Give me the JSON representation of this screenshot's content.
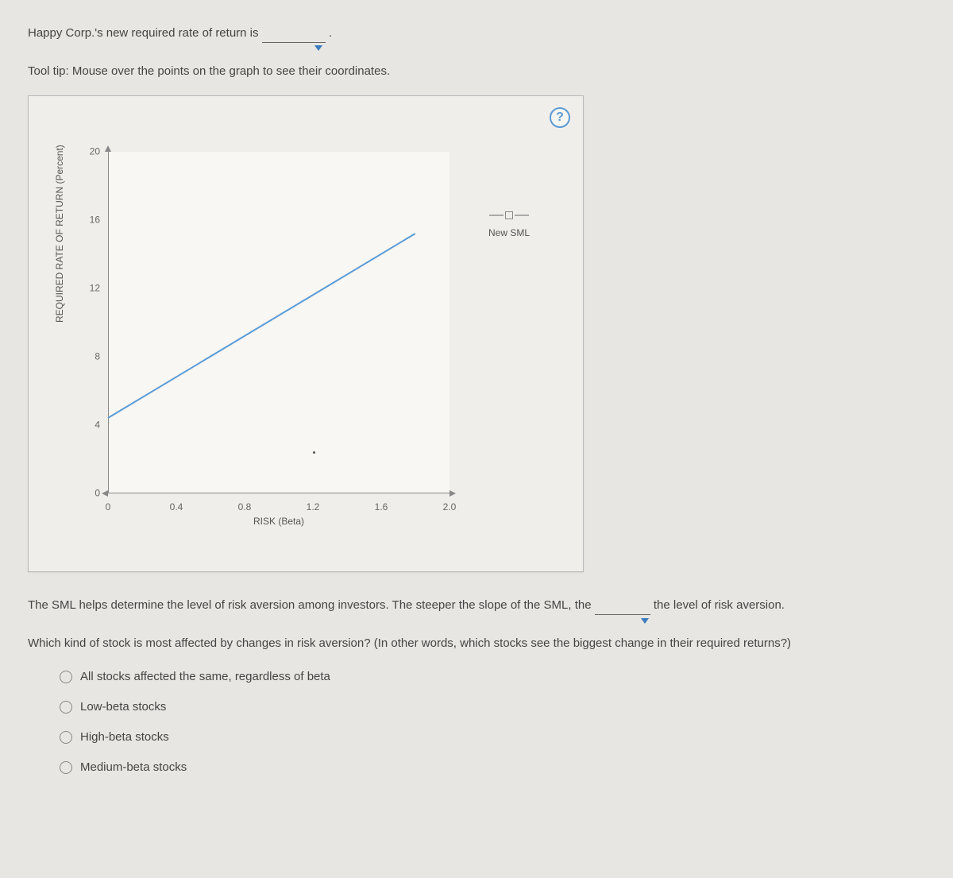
{
  "sentence1_prefix": "Happy Corp.'s new required rate of return is ",
  "sentence1_suffix": " .",
  "tooltip": "Tool tip: Mouse over the points on the graph to see their coordinates.",
  "help_label": "?",
  "legend": {
    "label": "New SML"
  },
  "chart_data": {
    "type": "line",
    "title": "",
    "xlabel": "RISK (Beta)",
    "ylabel": "REQUIRED RATE OF RETURN (Percent)",
    "x_ticks": [
      "0",
      "0.4",
      "0.8",
      "1.2",
      "1.6",
      "2.0"
    ],
    "y_ticks": [
      "0",
      "4",
      "8",
      "12",
      "16",
      "20"
    ],
    "xlim": [
      0,
      2.0
    ],
    "ylim": [
      0,
      20
    ],
    "series": [
      {
        "name": "New SML",
        "x": [
          0,
          1.8
        ],
        "y": [
          4.4,
          15.2
        ],
        "color": "#5b9bd5"
      }
    ]
  },
  "sml_text_a": "The SML helps determine the level of risk aversion among investors. The steeper the slope of the SML, the ",
  "sml_text_b": " the level of risk aversion.",
  "question": "Which kind of stock is most affected by changes in risk aversion? (In other words, which stocks see the biggest change in their required returns?)",
  "options": [
    "All stocks affected the same, regardless of beta",
    "Low-beta stocks",
    "High-beta stocks",
    "Medium-beta stocks"
  ]
}
